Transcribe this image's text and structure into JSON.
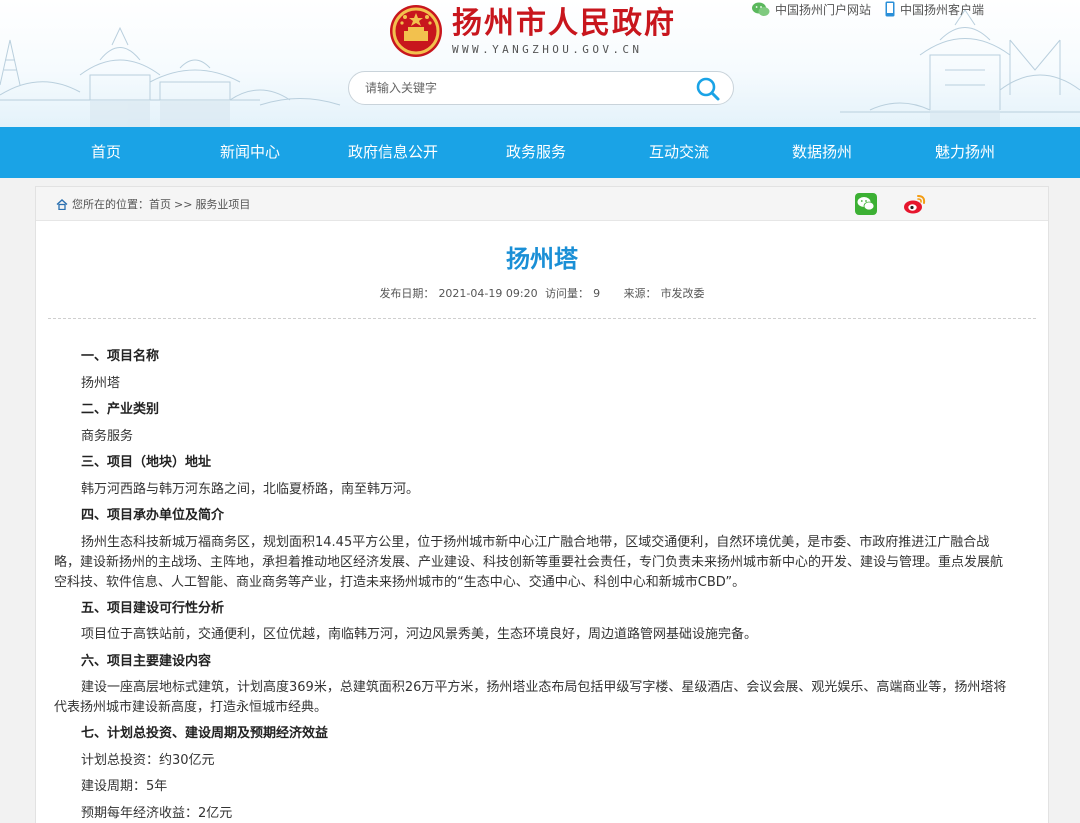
{
  "site": {
    "title": "扬州市人民政府",
    "url": "WWW.YANGZHOU.GOV.CN",
    "top_links": [
      {
        "label": "中国扬州门户网站",
        "icon": "wechat-icon"
      },
      {
        "label": "中国扬州客户端",
        "icon": "mobile-icon"
      }
    ]
  },
  "search": {
    "placeholder": "请输入关键字",
    "value": ""
  },
  "nav": {
    "items": [
      "首页",
      "新闻中心",
      "政府信息公开",
      "政务服务",
      "互动交流",
      "数据扬州",
      "魅力扬州"
    ]
  },
  "breadcrumb": {
    "prefix": "您所在的位置：",
    "items": [
      "首页",
      "服务业项目"
    ],
    "separator": ">>"
  },
  "share": {
    "icons": [
      "wechat-share-icon",
      "weibo-share-icon"
    ]
  },
  "article": {
    "title": "扬州塔",
    "meta": {
      "date_label": "发布日期：",
      "date": "2021-04-19 09:20",
      "views_label": "访问量：",
      "views": "9",
      "source_label": "来源：",
      "source": "市发改委"
    },
    "sections": [
      {
        "heading": "一、项目名称",
        "lines": [
          "扬州塔"
        ]
      },
      {
        "heading": "二、产业类别",
        "lines": [
          "商务服务"
        ]
      },
      {
        "heading": "三、项目（地块）地址",
        "lines": [
          "韩万河西路与韩万河东路之间，北临夏桥路，南至韩万河。"
        ]
      },
      {
        "heading": "四、项目承办单位及简介",
        "lines": [
          "扬州生态科技新城万福商务区，规划面积14.45平方公里，位于扬州城市新中心江广融合地带，区域交通便利，自然环境优美，是市委、市政府推进江广融合战略，建设新扬州的主战场、主阵地，承担着推动地区经济发展、产业建设、科技创新等重要社会责任，专门负责未来扬州城市新中心的开发、建设与管理。重点发展航空科技、软件信息、人工智能、商业商务等产业，打造未来扬州城市的“生态中心、交通中心、科创中心和新城市CBD”。"
        ]
      },
      {
        "heading": "五、项目建设可行性分析",
        "lines": [
          "项目位于高铁站前，交通便利，区位优越，南临韩万河，河边风景秀美，生态环境良好，周边道路管网基础设施完备。"
        ]
      },
      {
        "heading": "六、项目主要建设内容",
        "lines": [
          "建设一座高层地标式建筑，计划高度369米，总建筑面积26万平方米，扬州塔业态布局包括甲级写字楼、星级酒店、会议会展、观光娱乐、高端商业等，扬州塔将代表扬州城市建设新高度，打造永恒城市经典。"
        ]
      },
      {
        "heading": "七、计划总投资、建设周期及预期经济效益",
        "lines": [
          "计划总投资：约30亿元",
          "建设周期：5年",
          "预期每年经济收益：2亿元"
        ]
      }
    ]
  },
  "colors": {
    "nav_bg": "#1aa3e6",
    "title_blue": "#1a8fd6",
    "brand_red": "#c8161d"
  }
}
